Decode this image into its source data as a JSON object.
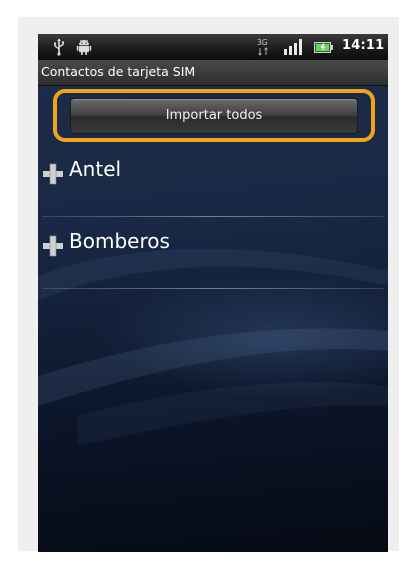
{
  "status_bar": {
    "network": "3G",
    "time": "14:11",
    "icons": [
      "usb-icon",
      "android-icon",
      "3g-icon",
      "signal-icon",
      "battery-icon"
    ]
  },
  "title_bar": {
    "title": "Contactos de tarjeta SIM"
  },
  "actions": {
    "import_all_label": "Importar todos"
  },
  "contacts": [
    {
      "name": "Antel",
      "icon": "plus-icon"
    },
    {
      "name": "Bomberos",
      "icon": "plus-icon"
    }
  ],
  "colors": {
    "highlight": "#f0a318",
    "background": "#182845"
  }
}
